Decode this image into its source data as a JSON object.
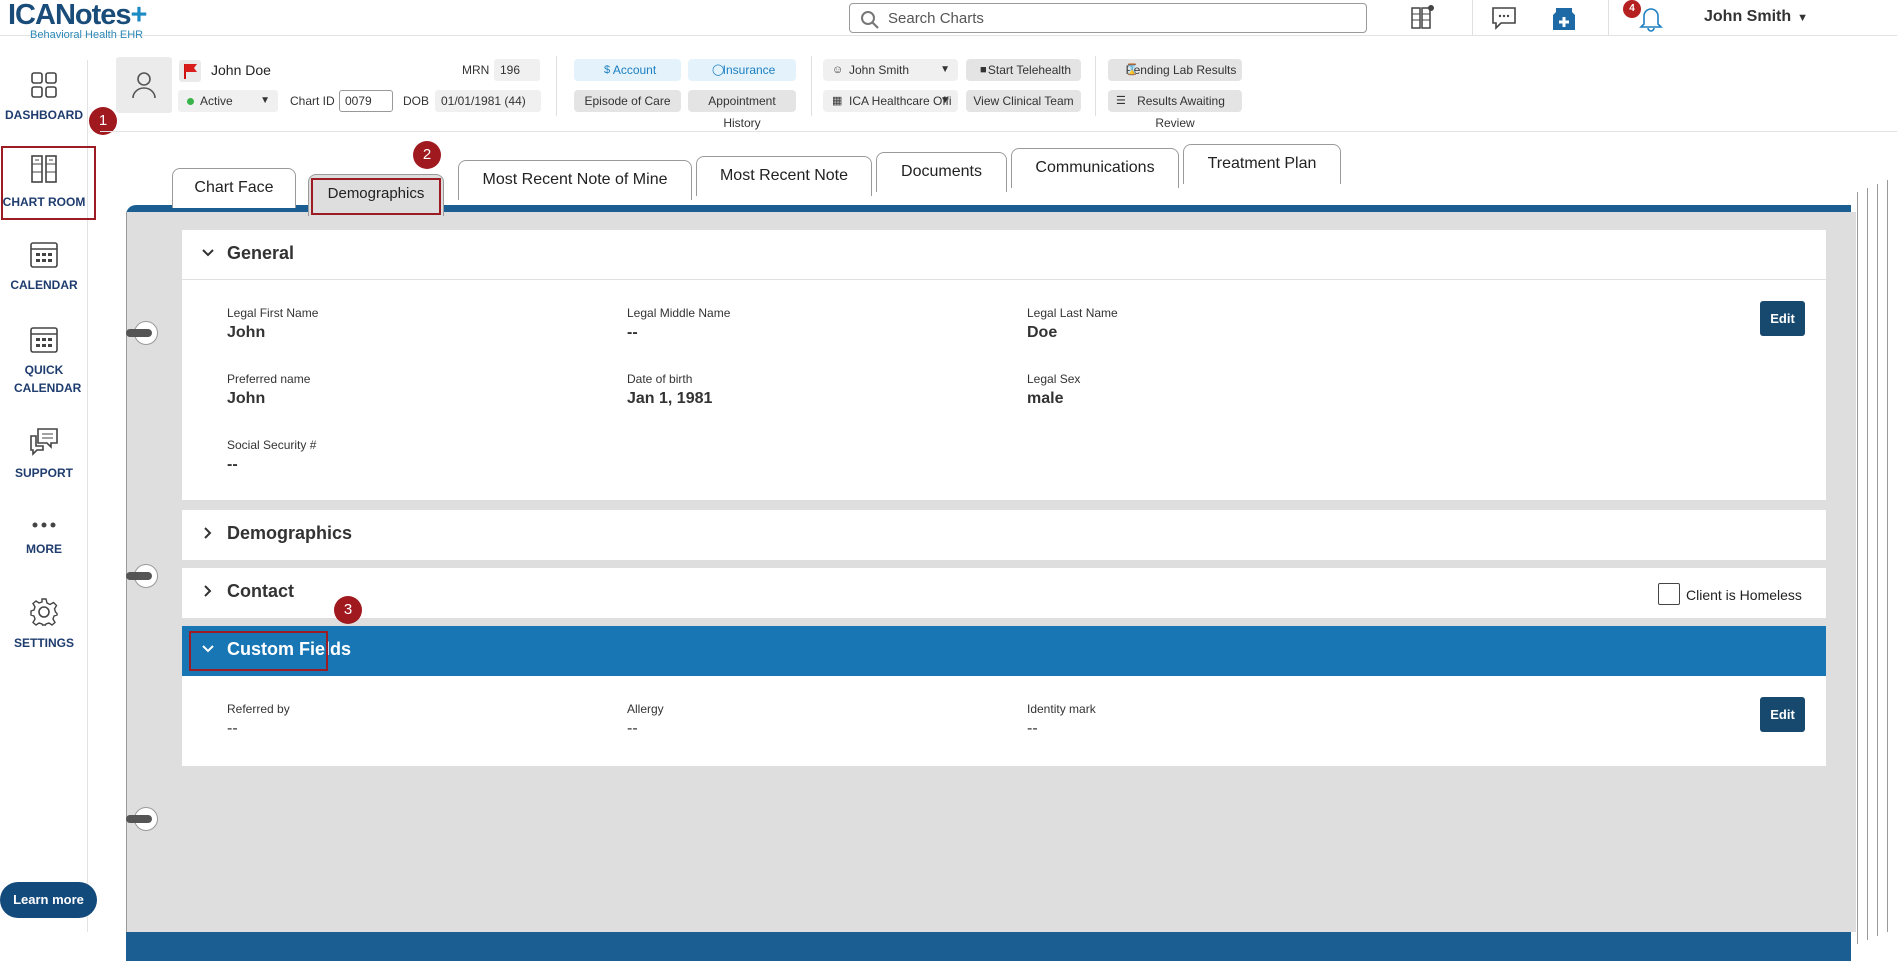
{
  "app": {
    "logo_main": "ICANotes",
    "logo_sub": "Behavioral Health EHR"
  },
  "topbar": {
    "search_placeholder": "Search Charts",
    "notifications_count": "4",
    "user_name": "John Smith"
  },
  "leftnav": {
    "items": [
      {
        "label": "DASHBOARD",
        "icon": "dashboard-icon"
      },
      {
        "label": "CHART ROOM",
        "icon": "chart-room-icon"
      },
      {
        "label": "CALENDAR",
        "icon": "calendar-icon"
      },
      {
        "label": "QUICK CALENDAR",
        "icon": "quick-calendar-icon"
      },
      {
        "label": "SUPPORT",
        "icon": "support-icon"
      },
      {
        "label": "MORE",
        "icon": "more-icon"
      },
      {
        "label": "SETTINGS",
        "icon": "settings-icon"
      }
    ],
    "learn_more": "Learn more"
  },
  "patient": {
    "name": "John Doe",
    "status": "Active",
    "mrn_label": "MRN",
    "mrn": "196",
    "chart_id_label": "Chart ID",
    "chart_id": "0079",
    "dob_label": "DOB",
    "dob": "01/01/1981 (44)",
    "buttons": {
      "account": "Account",
      "insurance": "Insurance",
      "episode": "Episode of Care",
      "appt_history": "Appointment History",
      "provider": "John Smith",
      "office": "ICA Healthcare Offi",
      "telehealth": "Start Telehealth",
      "clinical_team": "View Clinical Team",
      "pending_lab": "Pending Lab Results",
      "results_review": "Results Awaiting Review"
    }
  },
  "tabs": [
    "Chart Face",
    "Demographics",
    "Most Recent Note of Mine",
    "Most Recent Note",
    "Documents",
    "Communications",
    "Treatment Plan"
  ],
  "general": {
    "title": "General",
    "edit": "Edit",
    "fields": {
      "legal_first_name": {
        "label": "Legal First Name",
        "value": "John"
      },
      "legal_middle_name": {
        "label": "Legal Middle Name",
        "value": "--"
      },
      "legal_last_name": {
        "label": "Legal Last Name",
        "value": "Doe"
      },
      "preferred_name": {
        "label": "Preferred name",
        "value": "John"
      },
      "date_of_birth": {
        "label": "Date of birth",
        "value": "Jan 1, 1981"
      },
      "legal_sex": {
        "label": "Legal Sex",
        "value": "male"
      },
      "ssn": {
        "label": "Social Security #",
        "value": "--"
      }
    }
  },
  "demographics_section": {
    "title": "Demographics"
  },
  "contact": {
    "title": "Contact",
    "homeless_label": "Client is Homeless"
  },
  "custom_fields": {
    "title": "Custom Fields",
    "edit": "Edit",
    "fields": {
      "referred_by": {
        "label": "Referred by",
        "value": "--"
      },
      "allergy": {
        "label": "Allergy",
        "value": "--"
      },
      "identity_mark": {
        "label": "Identity mark",
        "value": "--"
      }
    }
  },
  "annotations": [
    "1",
    "2",
    "3"
  ],
  "colors": {
    "brand_navy": "#134a7c",
    "section_blue": "#1876b4",
    "edit_button": "#17496f",
    "highlight_red": "#9b1c22",
    "status_active": "#38b449"
  }
}
